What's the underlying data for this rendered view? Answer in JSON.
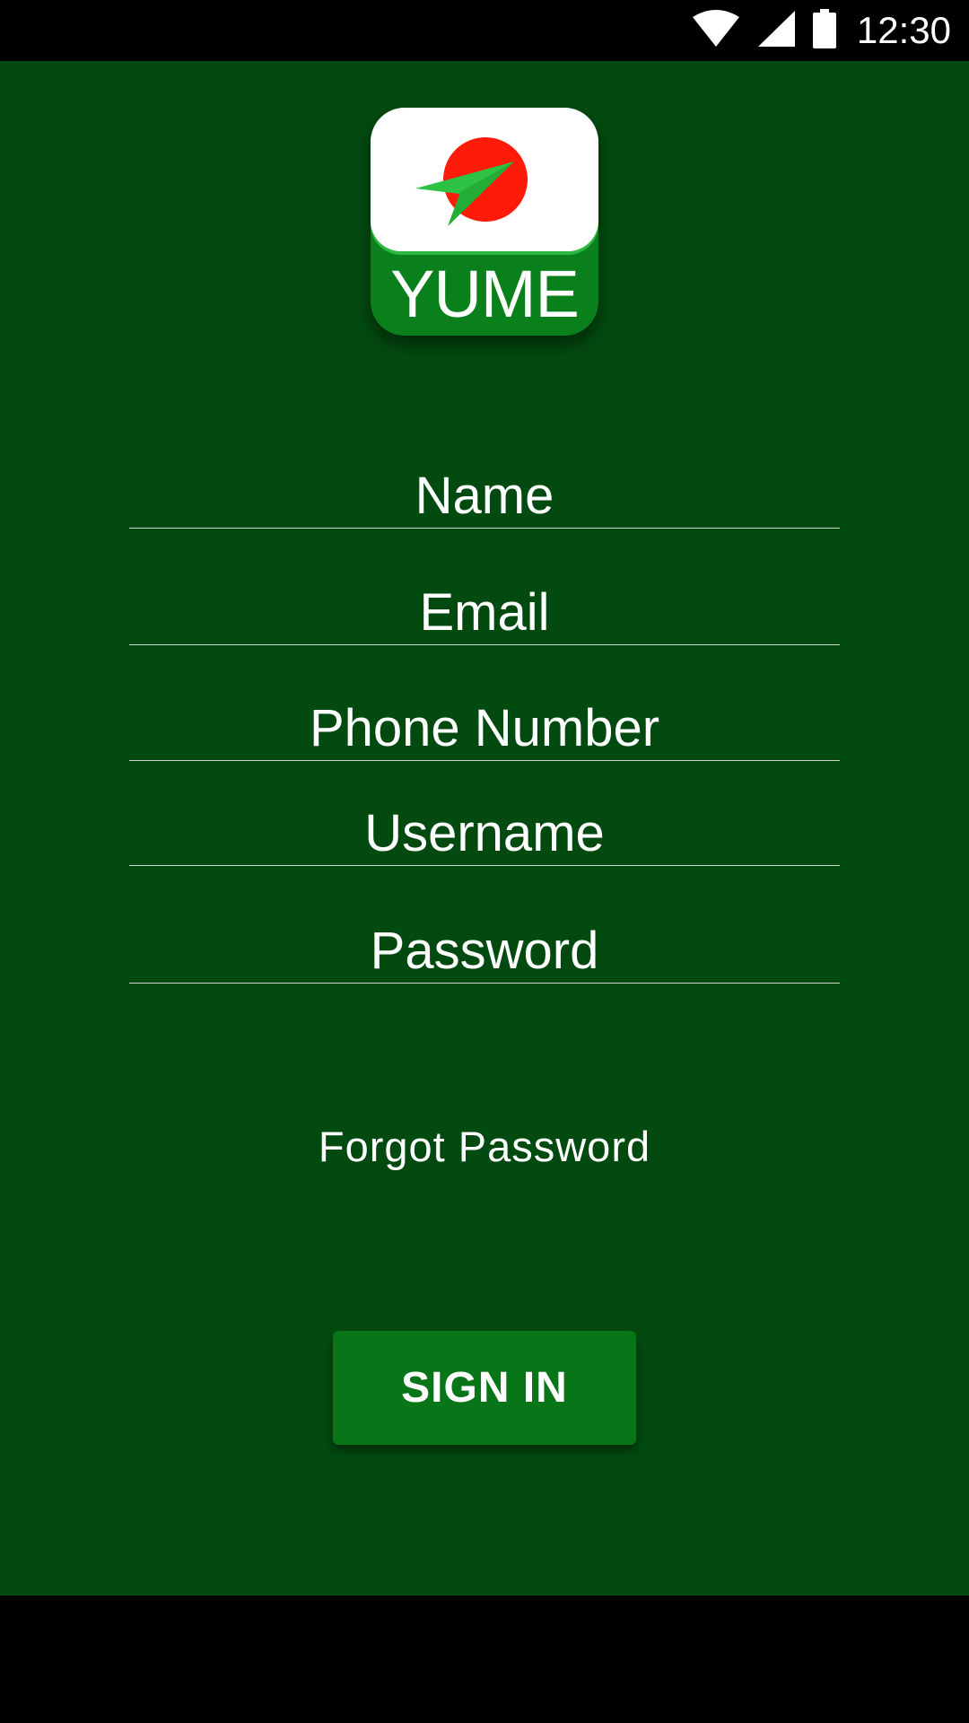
{
  "status_bar": {
    "time": "12:30",
    "icons": [
      "wifi-icon",
      "signal-icon",
      "battery-icon"
    ]
  },
  "logo": {
    "text": "YUME",
    "icon": "paper-plane-icon"
  },
  "form": {
    "name_placeholder": "Name",
    "email_placeholder": "Email",
    "phone_placeholder": "Phone Number",
    "username_placeholder": "Username",
    "password_placeholder": "Password"
  },
  "forgot_password": "Forgot Password",
  "sign_in_label": "SIGN IN",
  "colors": {
    "background": "#034a10",
    "button": "#077518",
    "logo_circle": "#ff1a0a",
    "plane": "#22c23a"
  }
}
